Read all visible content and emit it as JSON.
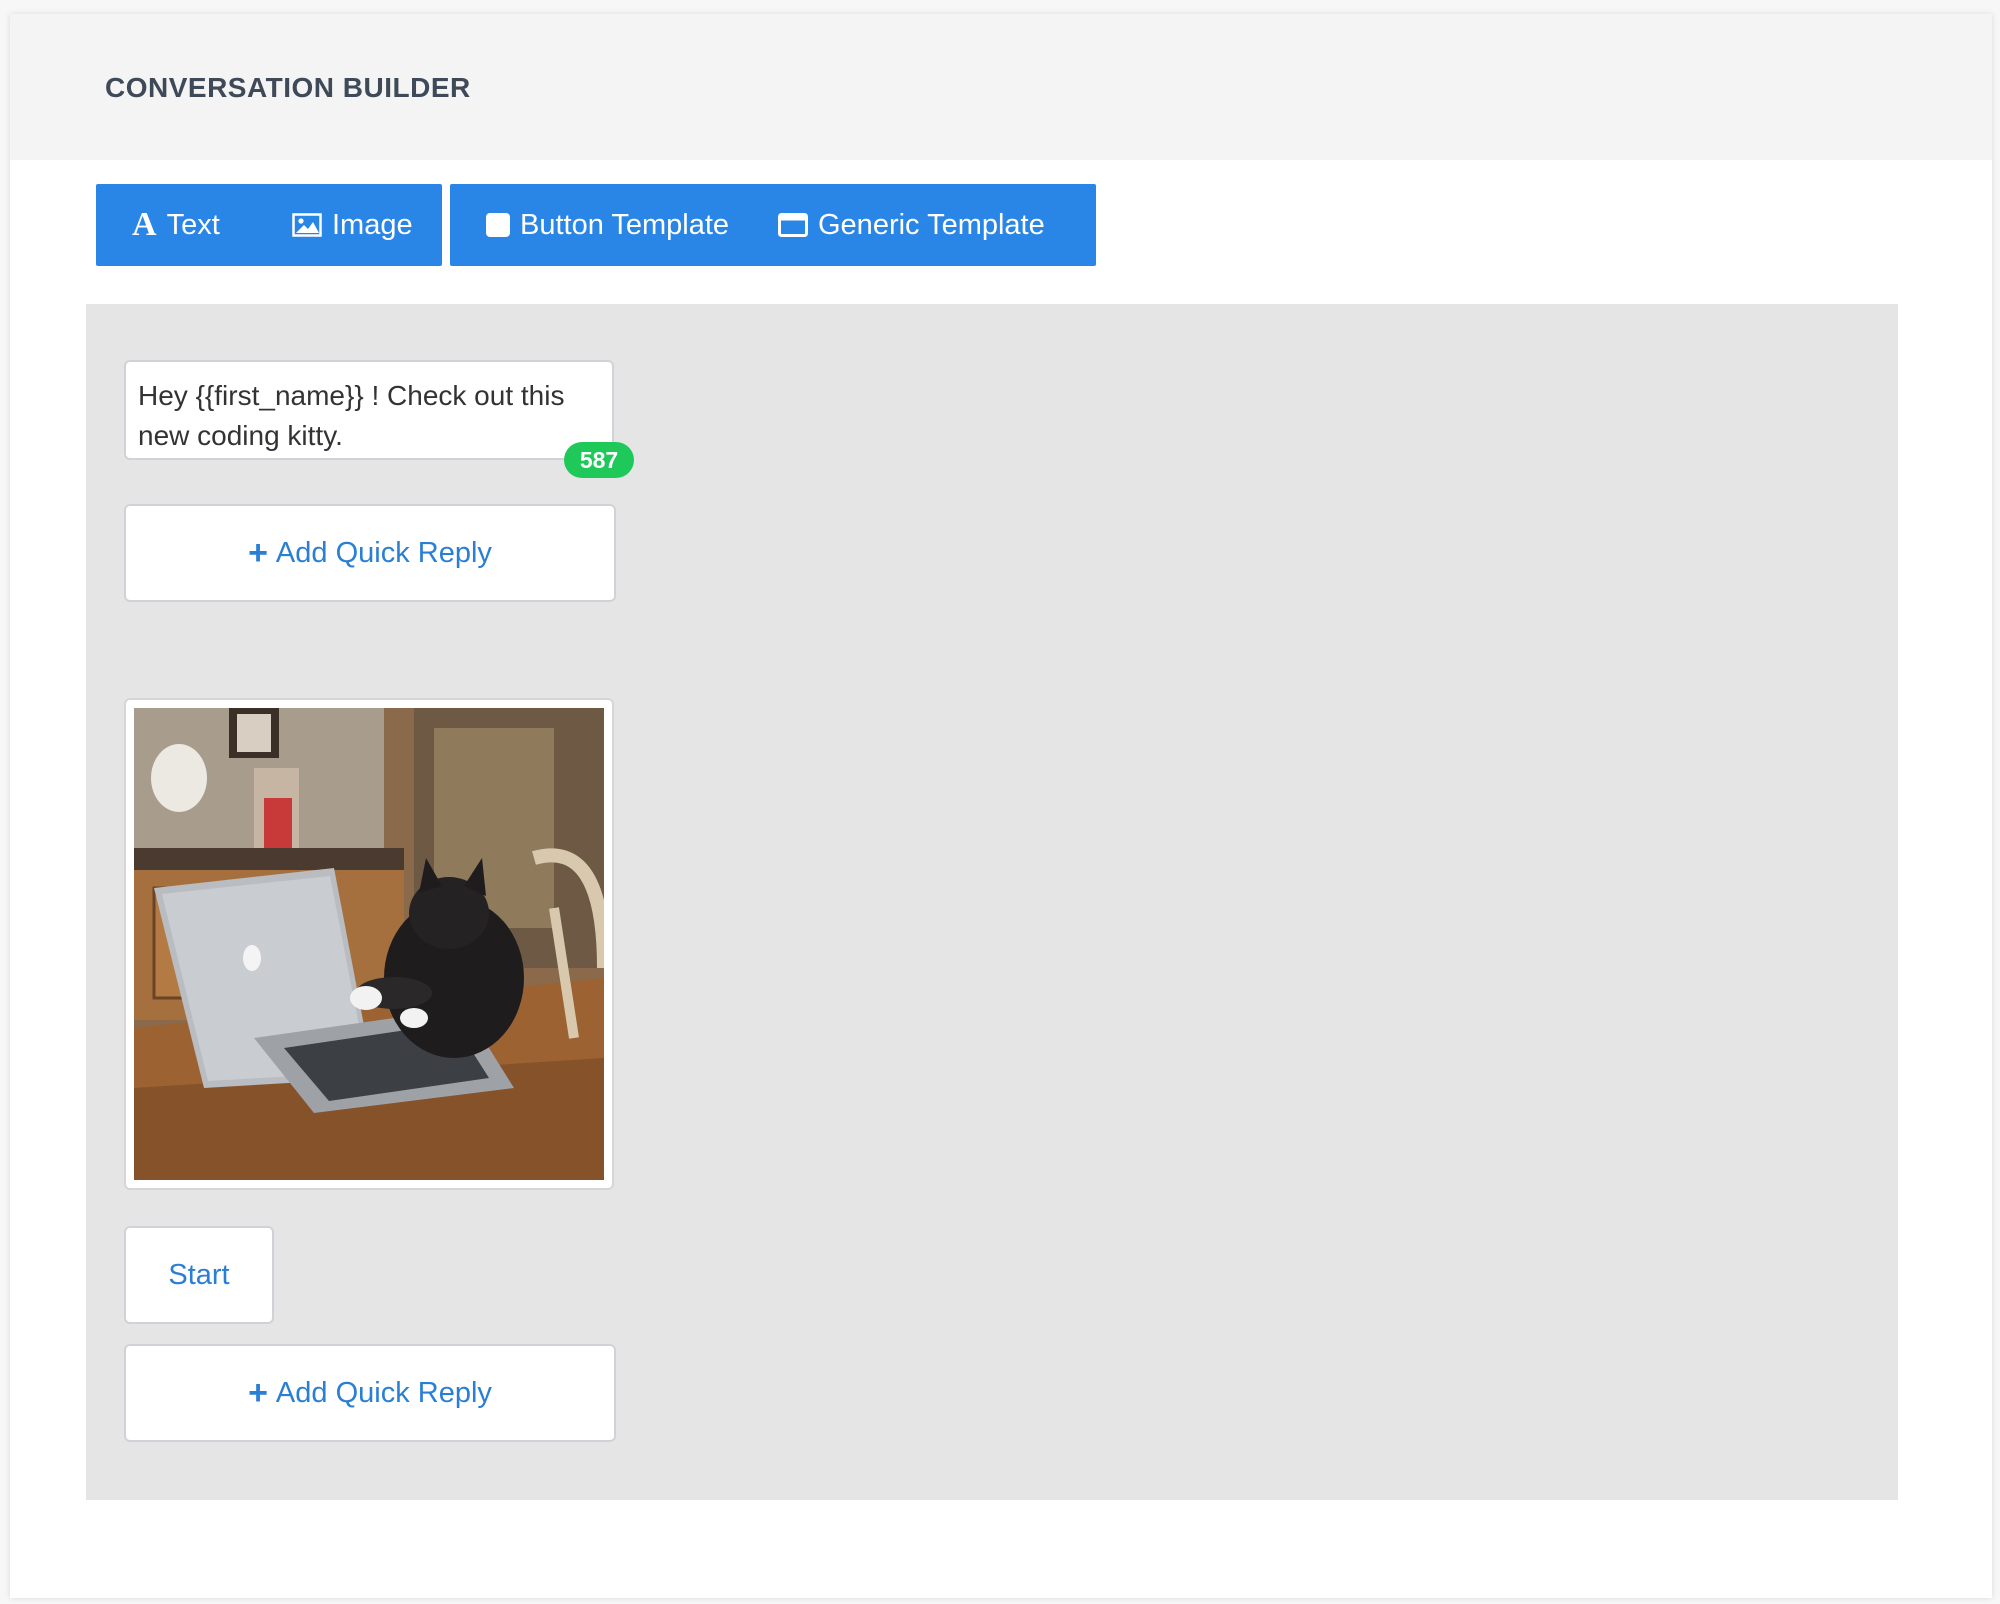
{
  "header": {
    "title": "CONVERSATION BUILDER"
  },
  "toolbar": {
    "text_label": "Text",
    "image_label": "Image",
    "button_template_label": "Button Template",
    "generic_template_label": "Generic Template",
    "accent_color": "#2a86e6"
  },
  "messages": {
    "text_message": "Hey {{first_name}} ! Check out this new coding kitty.",
    "char_count": "587",
    "image_icon_name": "cat-on-laptop-photo"
  },
  "quick_reply": {
    "add_label": "Add Quick Reply"
  },
  "start_button": {
    "label": "Start"
  },
  "colors": {
    "link": "#2a7fd4",
    "badge": "#1ec95a",
    "canvas": "#e5e5e5"
  }
}
